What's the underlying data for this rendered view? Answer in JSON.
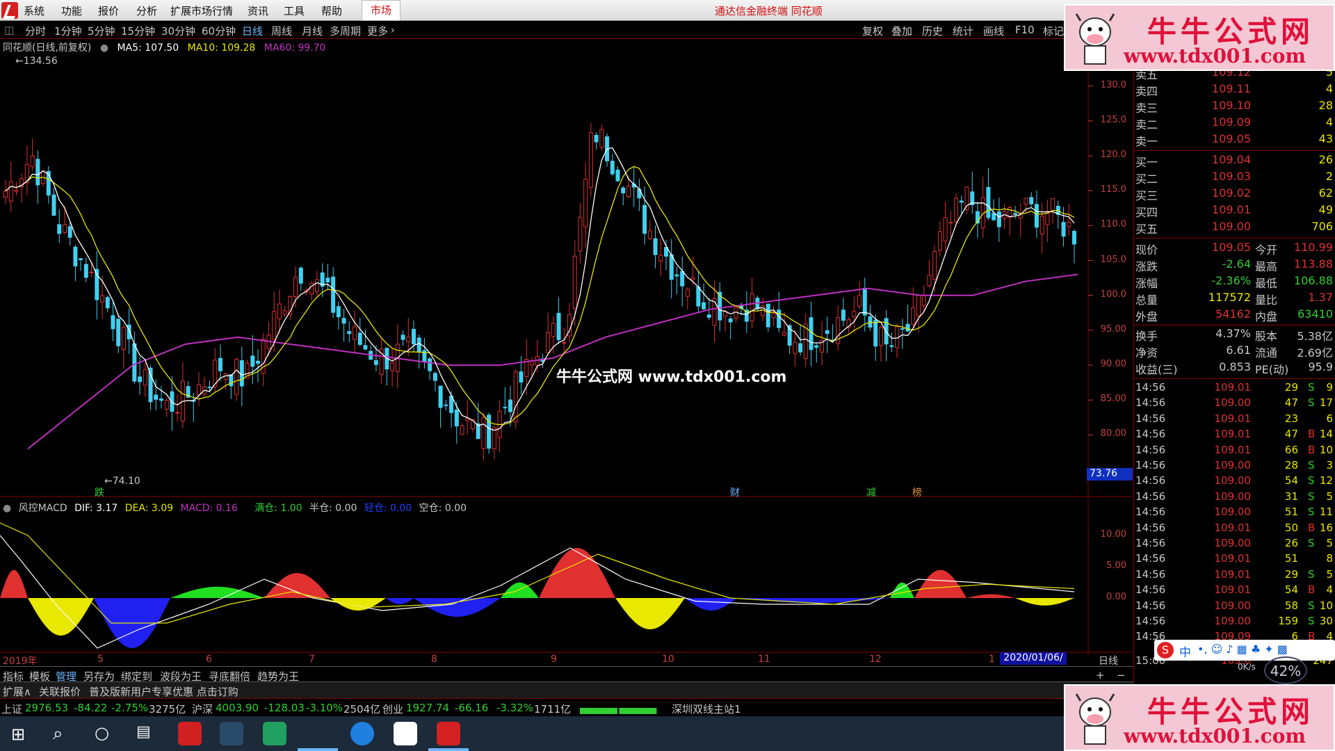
{
  "menubar": {
    "items": [
      "系统",
      "功能",
      "报价",
      "分析",
      "扩展市场行情",
      "资讯",
      "工具",
      "帮助"
    ],
    "market_tab": "市场",
    "title": "通达信金融终端  同花顺"
  },
  "toolbar": {
    "periods": [
      "分时",
      "1分钟",
      "5分钟",
      "15分钟",
      "30分钟",
      "60分钟",
      "日线",
      "周线",
      "月线",
      "多周期",
      "更多"
    ],
    "active": "日线",
    "right_buttons": [
      "复权",
      "叠加",
      "历史",
      "统计",
      "画线",
      "F10",
      "标记"
    ]
  },
  "main_chart": {
    "header": "同花顺(日线,前复权)",
    "ma5_label": "MA5: 107.50",
    "ma10_label": "MA10: 109.28",
    "ma60_label": "MA60: 99.70",
    "high_mark": "134.56",
    "low_mark": "74.10",
    "price_tag": "73.76",
    "markers": [
      "跌",
      "财",
      "减",
      "榜"
    ],
    "y_ticks": [
      "130.0",
      "125.0",
      "120.0",
      "115.0",
      "110.0",
      "105.0",
      "100.0",
      "95.00",
      "90.00",
      "85.00",
      "80.00"
    ]
  },
  "macd": {
    "name": "风控MACD",
    "dif": "DIF: 3.17",
    "dea": "DEA: 3.09",
    "macd": "MACD: 0.16",
    "full": "满仓: 1.00",
    "half": "半仓: 0.00",
    "light": "轻仓: 0.00",
    "empty": "空仓: 0.00",
    "y_ticks": [
      "10.00",
      "5.00",
      "0.00"
    ],
    "x_ticks": [
      "2019年",
      "5",
      "6",
      "7",
      "8",
      "9",
      "10",
      "11",
      "12",
      "1"
    ],
    "date_box": "2020/01/06/—",
    "period_label": "日线"
  },
  "chart_data": {
    "type": "candlestick",
    "title": "同花顺(日线,前复权)",
    "ylim": [
      73.76,
      134.56
    ],
    "x_ticks": [
      "2019年",
      "5",
      "6",
      "7",
      "8",
      "9",
      "10",
      "11",
      "12",
      "1"
    ],
    "close_samples": [
      115,
      120,
      110,
      104,
      97,
      88,
      84,
      86,
      90,
      88,
      96,
      104,
      100,
      94,
      91,
      92,
      88,
      82,
      80,
      86,
      92,
      96,
      124,
      118,
      110,
      104,
      100,
      98,
      99,
      94,
      94,
      96,
      98,
      92,
      96,
      108,
      114,
      110,
      112,
      112,
      109
    ],
    "ma60_samples": [
      78,
      84,
      90,
      93,
      94,
      93,
      92,
      91,
      90,
      90,
      91,
      94,
      96,
      98,
      99,
      100,
      101,
      100,
      100,
      102,
      103
    ]
  },
  "quote": {
    "asks": [
      {
        "label": "卖五",
        "price": "109.12",
        "vol": "5"
      },
      {
        "label": "卖四",
        "price": "109.11",
        "vol": "4"
      },
      {
        "label": "卖三",
        "price": "109.10",
        "vol": "28"
      },
      {
        "label": "卖二",
        "price": "109.09",
        "vol": "4"
      },
      {
        "label": "卖一",
        "price": "109.05",
        "vol": "43"
      }
    ],
    "bids": [
      {
        "label": "买一",
        "price": "109.04",
        "vol": "26"
      },
      {
        "label": "买二",
        "price": "109.03",
        "vol": "2"
      },
      {
        "label": "买三",
        "price": "109.02",
        "vol": "62"
      },
      {
        "label": "买四",
        "price": "109.01",
        "vol": "49"
      },
      {
        "label": "买五",
        "price": "109.00",
        "vol": "706"
      }
    ],
    "stats": [
      {
        "l1": "现价",
        "v1": "109.05",
        "l2": "今开",
        "v2": "110.99",
        "c1": "#e03030",
        "c2": "#e03030"
      },
      {
        "l1": "涨跌",
        "v1": "-2.64",
        "l2": "最高",
        "v2": "113.88",
        "c1": "#30d030",
        "c2": "#e03030"
      },
      {
        "l1": "涨幅",
        "v1": "-2.36%",
        "l2": "最低",
        "v2": "106.88",
        "c1": "#30d030",
        "c2": "#30d030"
      },
      {
        "l1": "总量",
        "v1": "117572",
        "l2": "量比",
        "v2": "1.37",
        "c1": "#e8e800",
        "c2": "#e03030"
      },
      {
        "l1": "外盘",
        "v1": "54162",
        "l2": "内盘",
        "v2": "63410",
        "c1": "#e03030",
        "c2": "#30d030"
      },
      {
        "l1": "换手",
        "v1": "4.37%",
        "l2": "股本",
        "v2": "5.38亿",
        "c1": "#c8c8c8",
        "c2": "#c8c8c8"
      },
      {
        "l1": "净资",
        "v1": "6.61",
        "l2": "流通",
        "v2": "2.69亿",
        "c1": "#c8c8c8",
        "c2": "#c8c8c8"
      },
      {
        "l1": "收益(三)",
        "v1": "0.853",
        "l2": "PE(动)",
        "v2": "95.9",
        "c1": "#c8c8c8",
        "c2": "#c8c8c8"
      }
    ],
    "ticks": [
      {
        "t": "14:56",
        "p": "109.01",
        "v": "29",
        "s": "S",
        "n": "9"
      },
      {
        "t": "14:56",
        "p": "109.00",
        "v": "47",
        "s": "S",
        "n": "17"
      },
      {
        "t": "14:56",
        "p": "109.01",
        "v": "23",
        "s": "",
        "n": "6"
      },
      {
        "t": "14:56",
        "p": "109.01",
        "v": "47",
        "s": "B",
        "n": "14"
      },
      {
        "t": "14:56",
        "p": "109.01",
        "v": "66",
        "s": "B",
        "n": "10"
      },
      {
        "t": "14:56",
        "p": "109.00",
        "v": "28",
        "s": "S",
        "n": "3"
      },
      {
        "t": "14:56",
        "p": "109.00",
        "v": "54",
        "s": "S",
        "n": "12"
      },
      {
        "t": "14:56",
        "p": "109.00",
        "v": "31",
        "s": "S",
        "n": "5"
      },
      {
        "t": "14:56",
        "p": "109.00",
        "v": "51",
        "s": "S",
        "n": "11"
      },
      {
        "t": "14:56",
        "p": "109.01",
        "v": "50",
        "s": "B",
        "n": "16"
      },
      {
        "t": "14:56",
        "p": "109.00",
        "v": "26",
        "s": "S",
        "n": "5"
      },
      {
        "t": "14:56",
        "p": "109.01",
        "v": "51",
        "s": "",
        "n": "8"
      },
      {
        "t": "14:56",
        "p": "109.01",
        "v": "29",
        "s": "S",
        "n": "5"
      },
      {
        "t": "14:56",
        "p": "109.01",
        "v": "54",
        "s": "B",
        "n": "4"
      },
      {
        "t": "14:56",
        "p": "109.00",
        "v": "58",
        "s": "S",
        "n": "10"
      },
      {
        "t": "14:56",
        "p": "109.00",
        "v": "159",
        "s": "S",
        "n": "30"
      },
      {
        "t": "14:56",
        "p": "109.09",
        "v": "6",
        "s": "B",
        "n": "4"
      }
    ],
    "last_time": "15:00",
    "last_price": "109.0",
    "last_n": "247"
  },
  "bottom_tabs": [
    "指标",
    "模板",
    "管理",
    "另存为",
    "绑定到",
    "波段为王",
    "寻底翻倍",
    "趋势为王"
  ],
  "ext_bar": [
    "扩展∧",
    "关联报价",
    "普及版新用户专享优惠 点击订购"
  ],
  "index_bar": {
    "sh": {
      "name": "上证",
      "val": "2976.53",
      "chg": "-84.22",
      "pct": "-2.75%",
      "amt": "3275亿"
    },
    "hs": {
      "name": "沪深",
      "val": "4003.90",
      "chg": "-128.03",
      "pct": "-3.10%",
      "amt": "2504亿"
    },
    "cy": {
      "name": "创业",
      "val": "1927.74",
      "chg": "-66.16",
      "pct": "-3.32%",
      "amt": "1711亿"
    },
    "server": "深圳双线主站1"
  },
  "watermark": {
    "title": "牛牛公式网",
    "url": "www.tdx001.com",
    "center": "牛牛公式网  www.tdx001.com"
  },
  "widgets": {
    "ime_zh": "中",
    "net_speed": "0K/s",
    "percent": "42%"
  },
  "colors": {
    "up": "#e03030",
    "down": "#30d030",
    "ma5": "#ffffff",
    "ma10": "#e8e800",
    "ma60": "#c030c0",
    "panel_border": "#800000"
  }
}
